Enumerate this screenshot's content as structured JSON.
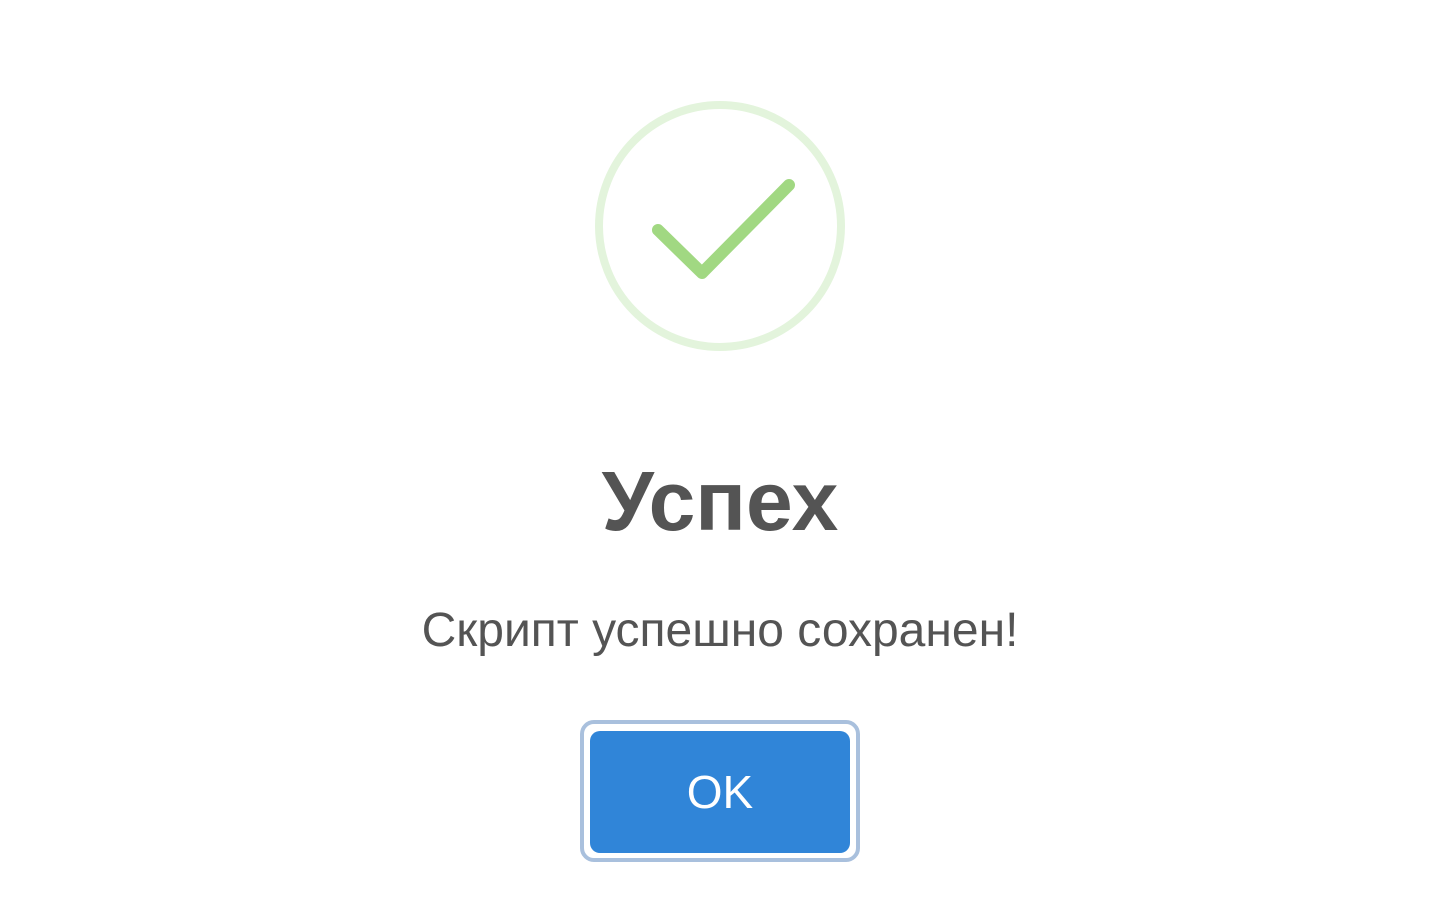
{
  "dialog": {
    "icon": "success-checkmark-icon",
    "title": "Успех",
    "message": "Скрипт успешно сохранен!",
    "confirm_label": "OK"
  },
  "colors": {
    "icon_ring": "#e3f4dc",
    "checkmark": "#a1d882",
    "text": "#545454",
    "button": "#3085d8",
    "focus_ring": "#a9c0dd"
  }
}
